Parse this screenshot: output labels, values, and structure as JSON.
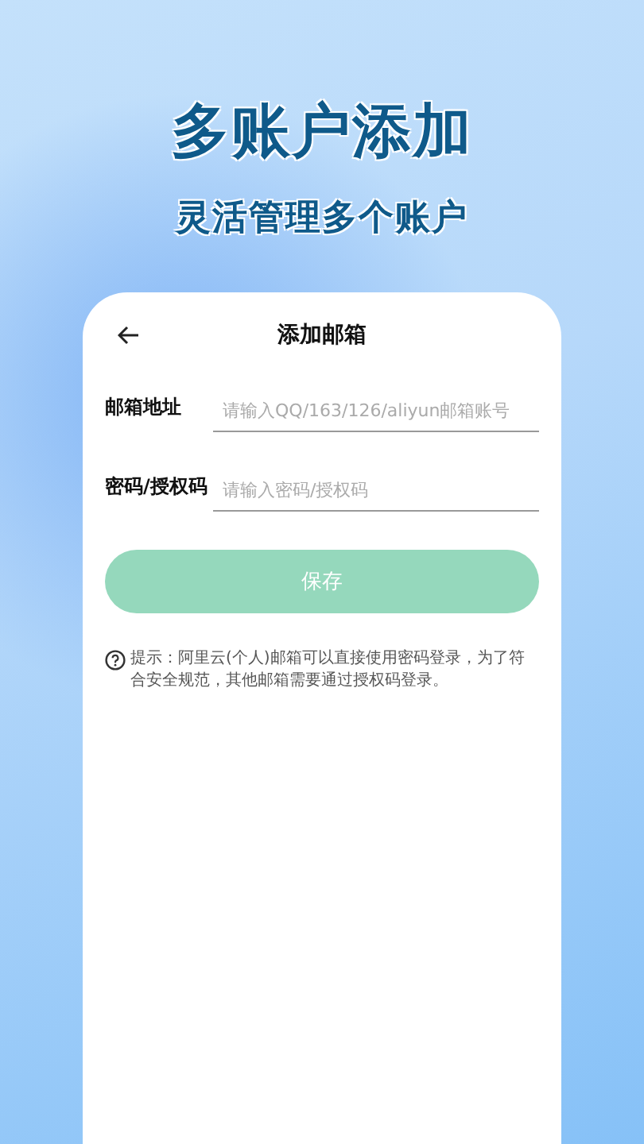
{
  "banner": {
    "title": "多账户添加",
    "subtitle": "灵活管理多个账户"
  },
  "screen": {
    "title": "添加邮箱",
    "fields": [
      {
        "label": "邮箱地址",
        "placeholder": "请输入QQ/163/126/aliyun邮箱账号"
      },
      {
        "label": "密码/授权码",
        "placeholder": "请输入密码/授权码"
      }
    ],
    "save_button": {
      "label": "保存",
      "disabled": true
    },
    "hint": "提示：阿里云(个人)邮箱可以直接使用密码登录，为了符合安全规范，其他邮箱需要通过授权码登录。"
  }
}
